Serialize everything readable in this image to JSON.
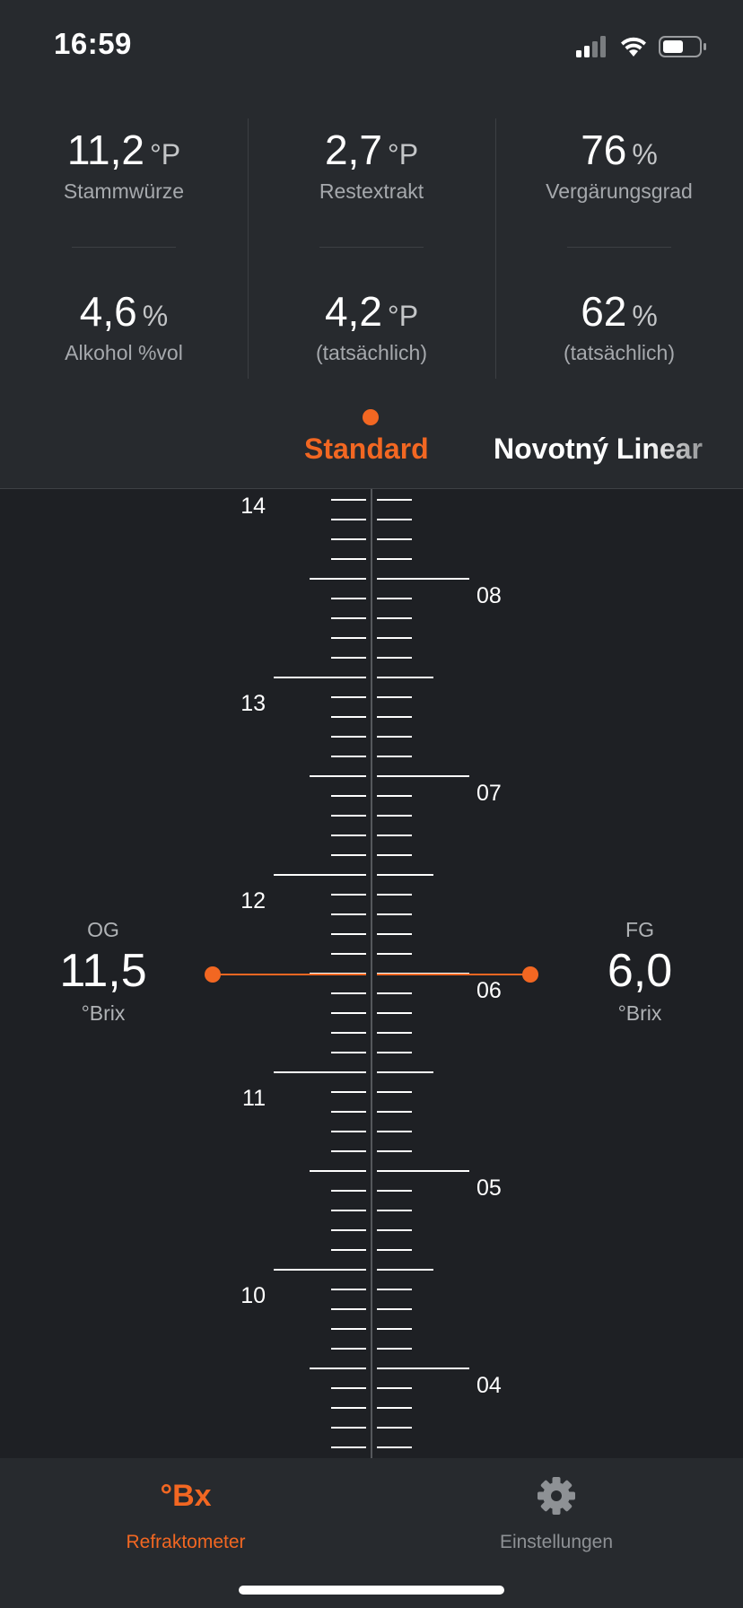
{
  "status_bar": {
    "time": "16:59"
  },
  "stats": [
    {
      "value": "11,2",
      "unit": "°P",
      "label": "Stammwürze"
    },
    {
      "value": "2,7",
      "unit": "°P",
      "label": "Restextrakt"
    },
    {
      "value": "76",
      "unit": "%",
      "label": "Vergärungsgrad"
    },
    {
      "value": "4,6",
      "unit": "%",
      "label": "Alkohol %vol"
    },
    {
      "value": "4,2",
      "unit": "°P",
      "label": "(tatsächlich)"
    },
    {
      "value": "62",
      "unit": "%",
      "label": "(tatsächlich)"
    }
  ],
  "tabs": [
    {
      "label": "Standard",
      "active": true
    },
    {
      "label": "Novotný Linear",
      "active": false
    }
  ],
  "scale": {
    "left_labels": [
      "14",
      "13",
      "12",
      "11",
      "10"
    ],
    "right_labels": [
      "08",
      "07",
      "06",
      "05",
      "04"
    ]
  },
  "og": {
    "label": "OG",
    "value": "11,5",
    "unit": "°Brix"
  },
  "fg": {
    "label": "FG",
    "value": "6,0",
    "unit": "°Brix"
  },
  "bottom_nav": [
    {
      "icon": "brix-icon",
      "icon_text": "°Bx",
      "label": "Refraktometer",
      "active": true
    },
    {
      "icon": "gear-icon",
      "label": "Einstellungen",
      "active": false
    }
  ],
  "colors": {
    "accent": "#f26722",
    "background": "#1e2024",
    "panel": "#272a2e",
    "inactive": "#8e9195"
  }
}
